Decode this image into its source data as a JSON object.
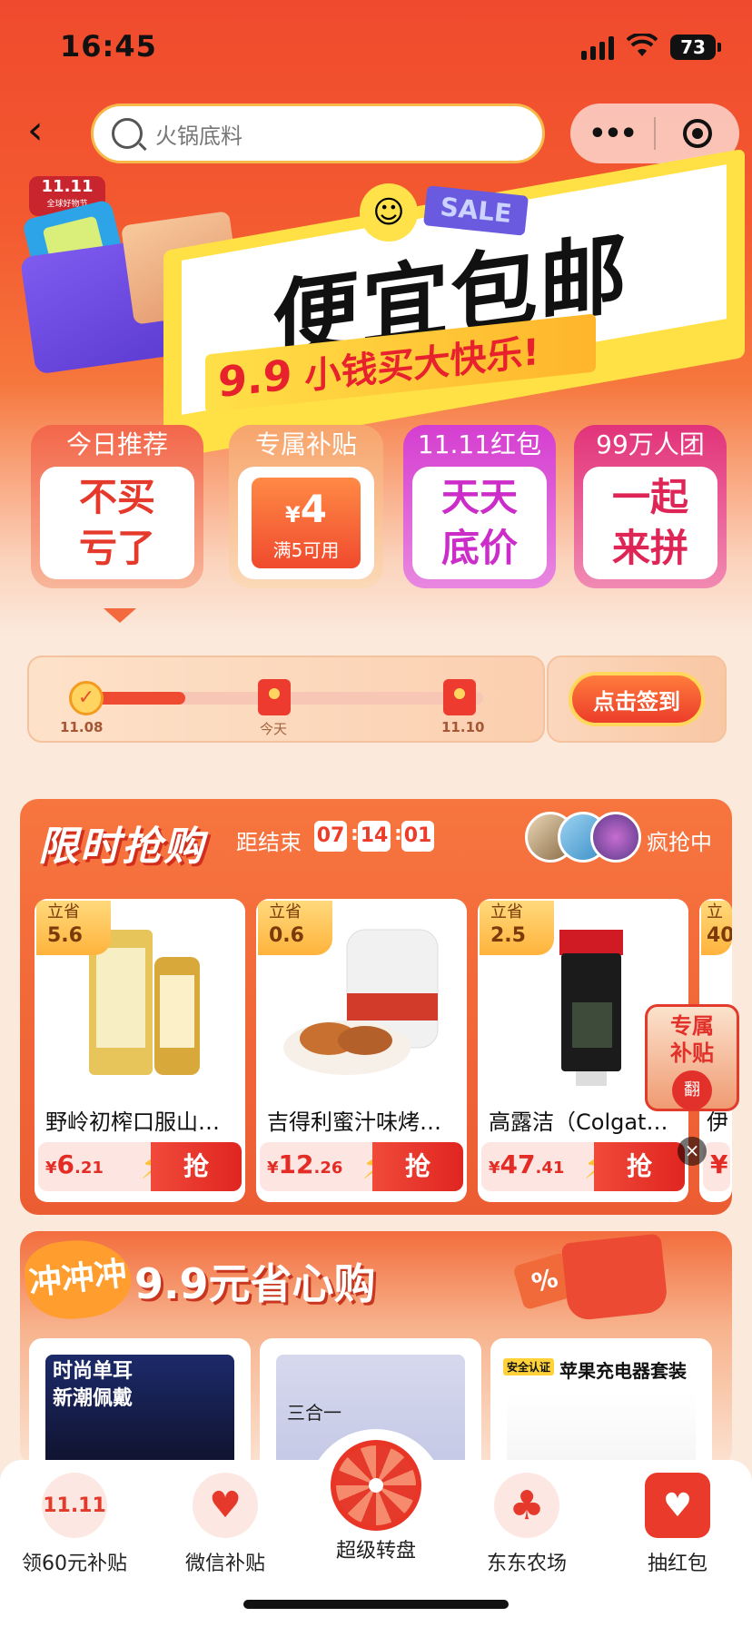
{
  "status_bar": {
    "time": "16:45",
    "battery": "73"
  },
  "nav": {
    "search_placeholder": "火锅底料",
    "more_icon": "more-dots-icon",
    "close_icon": "target-close-icon"
  },
  "banner": {
    "tag_line1": "11.11",
    "tag_line2": "全球好物节",
    "sale": "SALE",
    "main": "便宜包邮",
    "price": "9.9",
    "sub": "小钱买大快乐!"
  },
  "categories": [
    {
      "head": "今日推荐",
      "line1": "不买",
      "line2": "亏了"
    },
    {
      "head": "专属补贴",
      "amount": "4",
      "currency": "¥",
      "cond": "满5可用"
    },
    {
      "head": "11.11红包",
      "line1": "天天",
      "line2": "底价"
    },
    {
      "head": "99万人团",
      "line1": "一起",
      "line2": "来拼"
    }
  ],
  "checkin": {
    "days": [
      "11.08",
      "今天",
      "11.10"
    ],
    "button": "点击签到"
  },
  "flash_sale": {
    "title": "限时抢购",
    "ends_label": "距结束",
    "countdown": [
      "07",
      "14",
      "01"
    ],
    "status": "疯抢中",
    "products": [
      {
        "save_label": "立省",
        "save": "5.6",
        "name": "野岭初榨口服山茶油",
        "price_int": "6",
        "price_dec": ".21",
        "grab": "抢"
      },
      {
        "save_label": "立省",
        "save": "0.6",
        "name": "吉得利蜜汁味烤翅料",
        "price_int": "12",
        "price_dec": ".26",
        "grab": "抢"
      },
      {
        "save_label": "立省",
        "save": "2.5",
        "name": "高露洁（Colgate）牙膏",
        "price_int": "47",
        "price_dec": ".41",
        "grab": "抢"
      }
    ],
    "partial_save_label": "立",
    "partial_save": "40",
    "partial_name": "伊",
    "partial_price": "¥"
  },
  "float_subsidy": {
    "text1": "专属",
    "text2": "补贴",
    "circle": "翻"
  },
  "sec99": {
    "chong": "冲冲冲",
    "title": "9.9元省心购",
    "cards": [
      {
        "line1": "时尚单耳",
        "line2": "新潮佩戴"
      },
      {
        "line1": "三合一"
      },
      {
        "badge": "安全认证",
        "line1": "苹果充电器套装"
      }
    ]
  },
  "tabbar": [
    {
      "label": "领60元补贴",
      "icon": "1111-icon",
      "icon_text": "11.11"
    },
    {
      "label": "微信补贴",
      "icon": "heart-pulse-icon",
      "icon_text": "♥"
    },
    {
      "label": "超级转盘",
      "icon": "wheel-icon"
    },
    {
      "label": "东东农场",
      "icon": "tree-icon",
      "icon_text": "♣"
    },
    {
      "label": "抽红包",
      "icon": "red-envelope-icon",
      "icon_text": "♥"
    }
  ],
  "colors": {
    "accent": "#ec3d2a",
    "brand_orange": "#f35a30"
  }
}
